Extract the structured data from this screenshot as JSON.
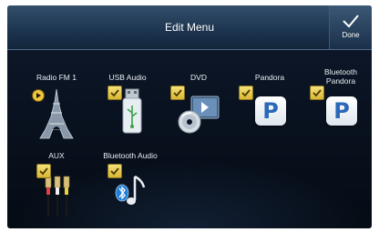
{
  "header": {
    "title": "Edit Menu",
    "done_label": "Done"
  },
  "sources": [
    {
      "label": "Radio FM 1",
      "icon": "eiffel-tower-icon",
      "checked": false,
      "playing": true
    },
    {
      "label": "USB Audio",
      "icon": "usb-drive-icon",
      "checked": true
    },
    {
      "label": "DVD",
      "icon": "dvd-icon",
      "checked": true
    },
    {
      "label": "Pandora",
      "icon": "pandora-icon",
      "checked": true
    },
    {
      "label": "Bluetooth\nPandora",
      "icon": "pandora-icon",
      "checked": true
    },
    {
      "label": "AUX",
      "icon": "rca-plugs-icon",
      "checked": true
    },
    {
      "label": "Bluetooth Audio",
      "icon": "bluetooth-music-icon",
      "checked": true
    }
  ],
  "colors": {
    "accent": "#e8c84a",
    "header": "#1d3550",
    "background": "#0a1322",
    "pandora_blue": "#2a68b8"
  }
}
